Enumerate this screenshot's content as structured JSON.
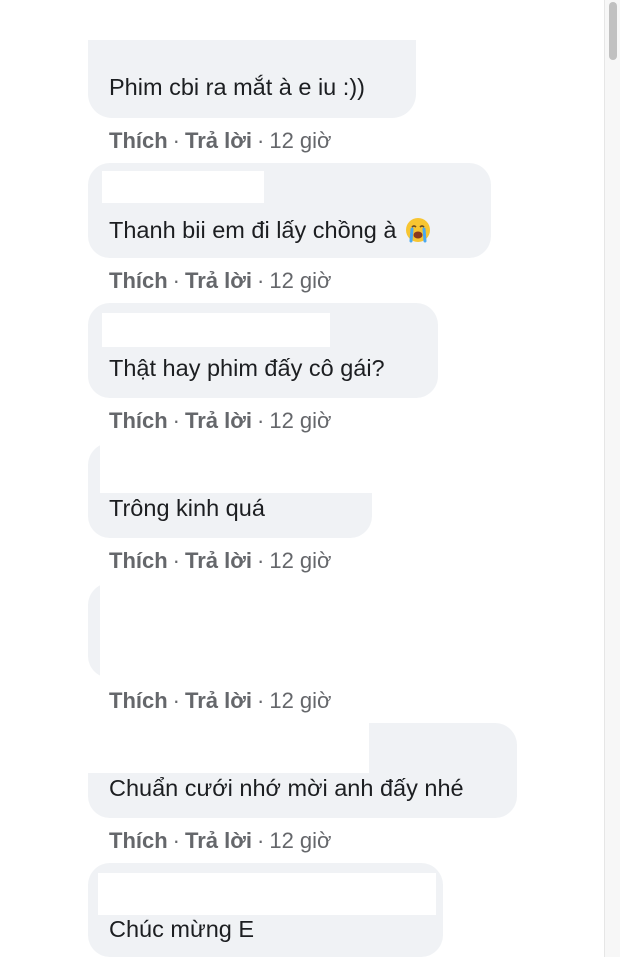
{
  "comments": [
    {
      "text": "Phim cbi ra mắt à e iu :))",
      "like": "Thích",
      "reply": "Trả lời",
      "time": "12 giờ"
    },
    {
      "text": "Thanh bii em đi lấy chồng à",
      "emoji": "crying-face-emoji",
      "like": "Thích",
      "reply": "Trả lời",
      "time": "12 giờ"
    },
    {
      "text": "Thật hay phim đấy cô gái?",
      "like": "Thích",
      "reply": "Trả lời",
      "time": "12 giờ"
    },
    {
      "text": "Trông kinh quá",
      "like": "Thích",
      "reply": "Trả lời",
      "time": "12 giờ"
    },
    {
      "text": "",
      "like": "Thích",
      "reply": "Trả lời",
      "time": "12 giờ"
    },
    {
      "text": "Chuẩn cưới nhớ mời anh đấy nhé",
      "like": "Thích",
      "reply": "Trả lời",
      "time": "12 giờ"
    },
    {
      "text": "Chúc mừng E"
    }
  ],
  "colors": {
    "bubble": "#f0f2f5",
    "text": "#1c1e21",
    "meta": "#65676b",
    "redaction": "#ffffff"
  }
}
